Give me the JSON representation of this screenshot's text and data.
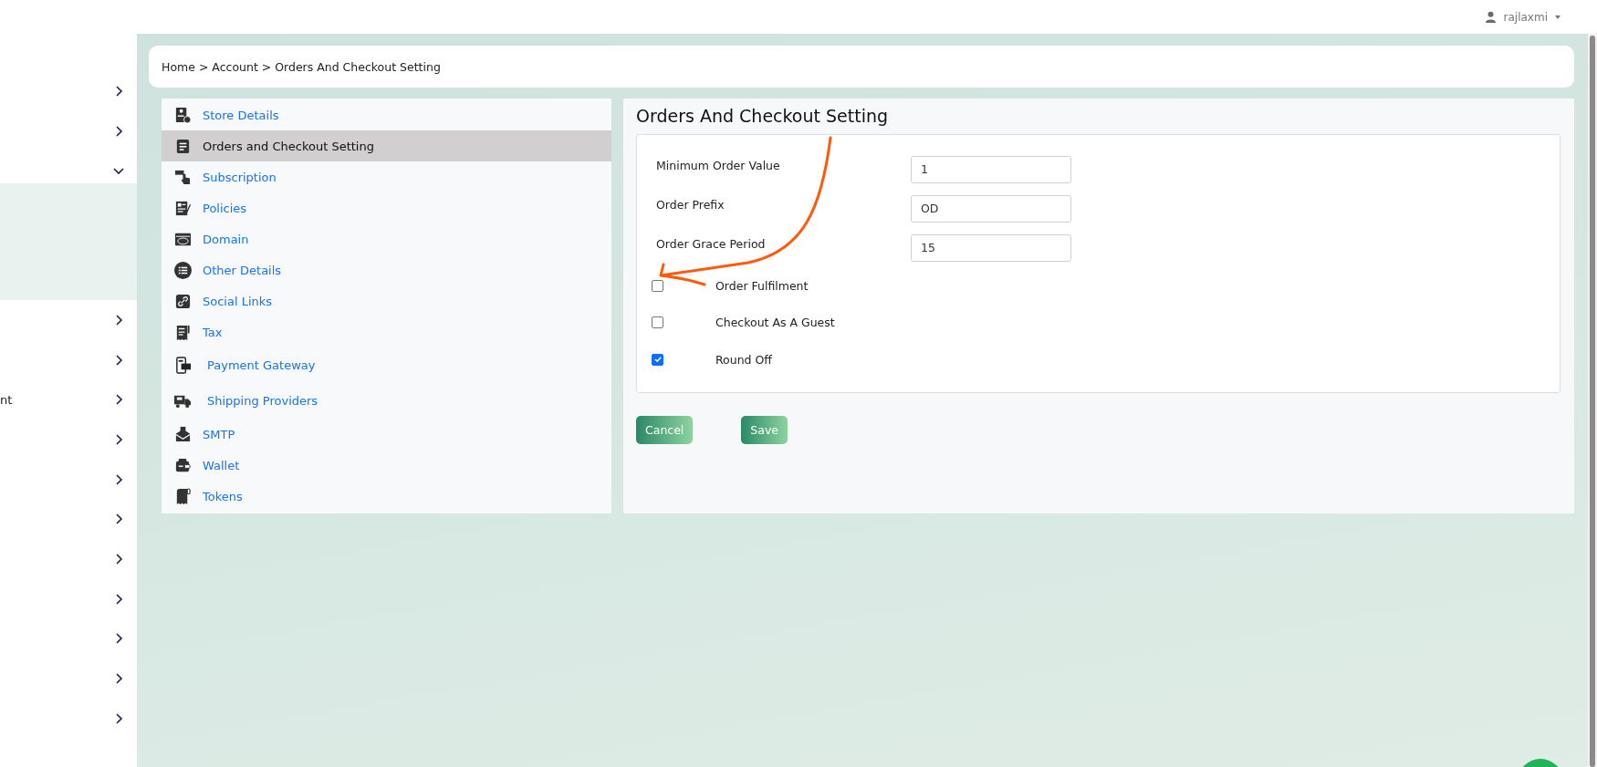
{
  "user": {
    "name": "rajlaxmi"
  },
  "sidebar": {
    "items": [
      {
        "expanded": false
      },
      {
        "expanded": false
      },
      {
        "expanded": true
      },
      {
        "expanded": false
      },
      {
        "expanded": false
      },
      {
        "expanded": false,
        "label": "nt"
      },
      {
        "expanded": false
      },
      {
        "expanded": false
      },
      {
        "expanded": false
      },
      {
        "expanded": false
      },
      {
        "expanded": false
      },
      {
        "expanded": false
      },
      {
        "expanded": false
      },
      {
        "expanded": false
      }
    ]
  },
  "breadcrumb": "Home > Account > Orders And Checkout Setting",
  "settings_menu": [
    {
      "label": "Store Details",
      "kind": "store",
      "selected": false
    },
    {
      "label": "Orders and Checkout Setting",
      "kind": "orders",
      "selected": true
    },
    {
      "label": "Subscription",
      "kind": "subscription",
      "selected": false
    },
    {
      "label": "Policies",
      "kind": "policies",
      "selected": false
    },
    {
      "label": "Domain",
      "kind": "domain",
      "selected": false
    },
    {
      "label": "Other Details",
      "kind": "list",
      "selected": false
    },
    {
      "label": "Social Links",
      "kind": "link",
      "selected": false
    },
    {
      "label": "Tax",
      "kind": "tax",
      "selected": false
    },
    {
      "label": "Payment Gateway",
      "kind": "payment",
      "selected": false
    },
    {
      "label": "Shipping Providers",
      "kind": "truck",
      "selected": false
    },
    {
      "label": "SMTP",
      "kind": "mail",
      "selected": false
    },
    {
      "label": "Wallet",
      "kind": "wallet",
      "selected": false
    },
    {
      "label": "Tokens",
      "kind": "token",
      "selected": false
    }
  ],
  "form": {
    "title": "Orders And Checkout Setting",
    "fields": [
      {
        "label": "Minimum Order Value",
        "value": "1"
      },
      {
        "label": "Order Prefix",
        "value": "OD"
      },
      {
        "label": "Order Grace Period",
        "value": "15"
      }
    ],
    "checkboxes": [
      {
        "label": "Order Fulfilment",
        "checked": false
      },
      {
        "label": "Checkout As A Guest",
        "checked": false
      },
      {
        "label": "Round Off",
        "checked": true
      }
    ],
    "buttons": [
      "Cancel",
      "Save"
    ]
  }
}
